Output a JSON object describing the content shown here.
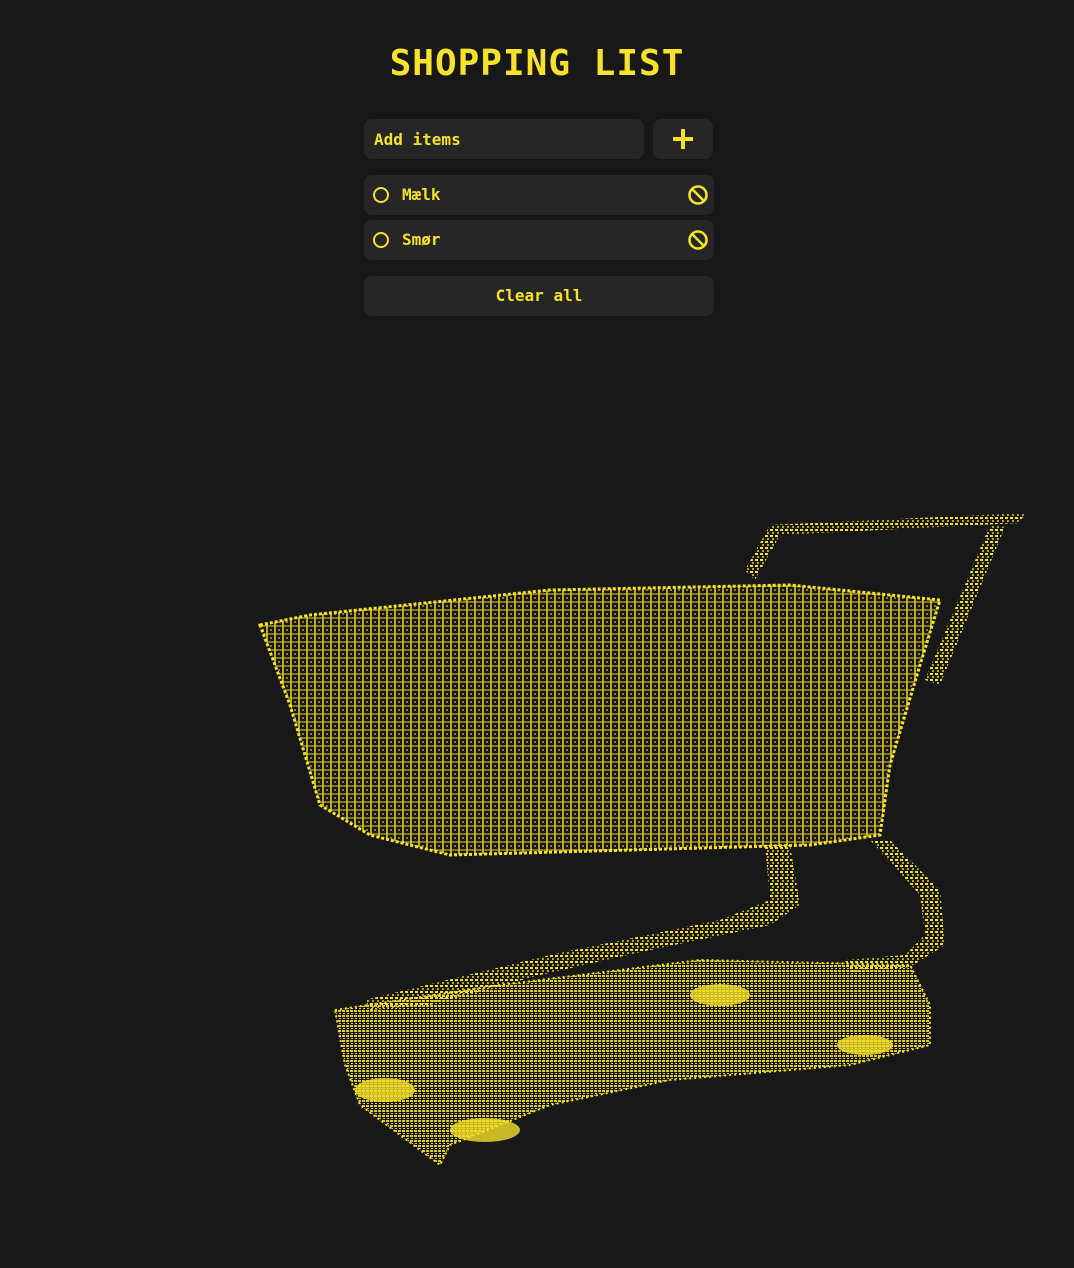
{
  "header": {
    "title": "SHOPPING LIST"
  },
  "add_form": {
    "placeholder": "Add items",
    "add_icon": "plus-icon"
  },
  "items": [
    {
      "label": "Mælk",
      "checked": false,
      "remove_icon": "ban-icon"
    },
    {
      "label": "Smør",
      "checked": false,
      "remove_icon": "ban-icon"
    }
  ],
  "clear_label": "Clear all",
  "decoration": {
    "name": "ascii-shopping-cart-art"
  },
  "colors": {
    "accent": "#f6e22c",
    "background": "#181818",
    "panel": "#262626"
  }
}
